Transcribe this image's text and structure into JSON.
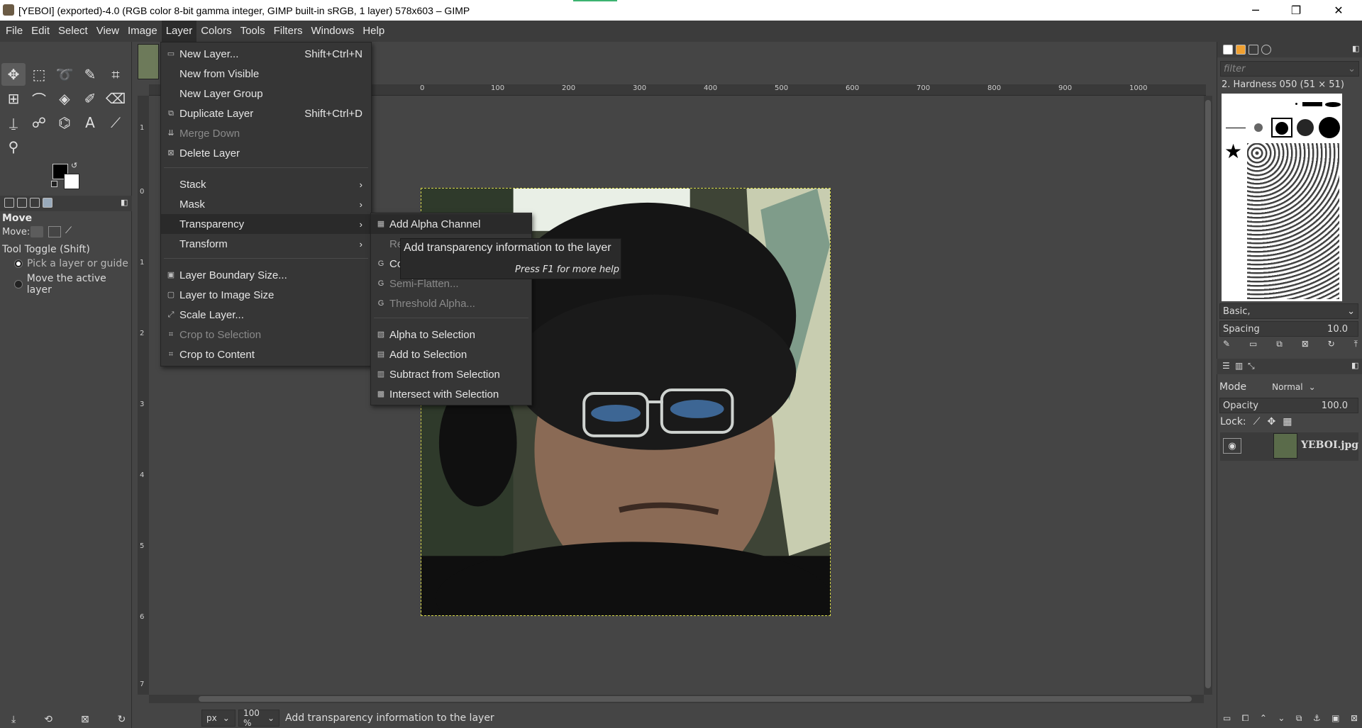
{
  "window": {
    "title": "[YEBOI] (exported)-4.0 (RGB color 8-bit gamma integer, GIMP built-in sRGB, 1 layer) 578x603 – GIMP",
    "minimize": "─",
    "maximize": "❐",
    "close": "✕"
  },
  "menubar": [
    "File",
    "Edit",
    "Select",
    "View",
    "Image",
    "Layer",
    "Colors",
    "Tools",
    "Filters",
    "Windows",
    "Help"
  ],
  "tool_options": {
    "title": "Move",
    "move_label": "Move:",
    "toggle_label": "Tool Toggle  (Shift)",
    "option1": "Pick a layer or guide",
    "option2": "Move the active layer"
  },
  "layer_menu": {
    "items": [
      {
        "label": "New Layer...",
        "shortcut": "Shift+Ctrl+N",
        "icon": "new-layer-icon",
        "enabled": true
      },
      {
        "label": "New from Visible",
        "shortcut": "",
        "icon": "",
        "enabled": true
      },
      {
        "label": "New Layer Group",
        "shortcut": "",
        "icon": "",
        "enabled": true
      },
      {
        "label": "Duplicate Layer",
        "shortcut": "Shift+Ctrl+D",
        "icon": "duplicate-icon",
        "enabled": true
      },
      {
        "label": "Merge Down",
        "shortcut": "",
        "icon": "merge-icon",
        "enabled": false
      },
      {
        "label": "Delete Layer",
        "shortcut": "",
        "icon": "delete-icon",
        "enabled": true
      },
      {
        "label": "Stack",
        "submenu": true
      },
      {
        "label": "Mask",
        "submenu": true
      },
      {
        "label": "Transparency",
        "submenu": true,
        "highlighted": true
      },
      {
        "label": "Transform",
        "submenu": true
      },
      {
        "label": "Layer Boundary Size...",
        "icon": "boundary-icon",
        "enabled": true
      },
      {
        "label": "Layer to Image Size",
        "icon": "to-image-icon",
        "enabled": true
      },
      {
        "label": "Scale Layer...",
        "icon": "scale-icon",
        "enabled": true
      },
      {
        "label": "Crop to Selection",
        "icon": "crop-icon",
        "enabled": false
      },
      {
        "label": "Crop to Content",
        "icon": "crop-icon",
        "enabled": true
      }
    ]
  },
  "transparency_menu": {
    "items": [
      {
        "label": "Add Alpha Channel",
        "enabled": true
      },
      {
        "label": "Re",
        "enabled": false
      },
      {
        "label": "Co",
        "enabled": true
      },
      {
        "label": "Semi-Flatten...",
        "enabled": false
      },
      {
        "label": "Threshold Alpha...",
        "enabled": false
      },
      {
        "label": "Alpha to Selection",
        "enabled": true
      },
      {
        "label": "Add to Selection",
        "enabled": true
      },
      {
        "label": "Subtract from Selection",
        "enabled": true
      },
      {
        "label": "Intersect with Selection",
        "enabled": true
      }
    ]
  },
  "tooltip": {
    "text": "Add transparency information to the layer",
    "hint": "Press F1 for more help"
  },
  "ruler": {
    "h_ticks": [
      "0",
      "100",
      "200",
      "300",
      "400",
      "500",
      "600",
      "700",
      "800",
      "900",
      "1000"
    ],
    "v_ticks": [
      "1",
      "0",
      "1",
      "2",
      "3",
      "4",
      "5",
      "6",
      "7"
    ]
  },
  "statusbar": {
    "unit": "px",
    "zoom": "100 %",
    "message": "Add transparency information to the layer"
  },
  "brushes": {
    "filter_placeholder": "filter",
    "current": "2. Hardness 050 (51 × 51)",
    "preset": "Basic,",
    "spacing_label": "Spacing",
    "spacing_value": "10.0"
  },
  "layers": {
    "mode_label": "Mode",
    "mode_value": "Normal",
    "opacity_label": "Opacity",
    "opacity_value": "100.0",
    "lock_label": "Lock:",
    "layer_name": "YEBOI.jpg"
  },
  "colors": {
    "foreground": "#000000",
    "background": "#ffffff"
  }
}
